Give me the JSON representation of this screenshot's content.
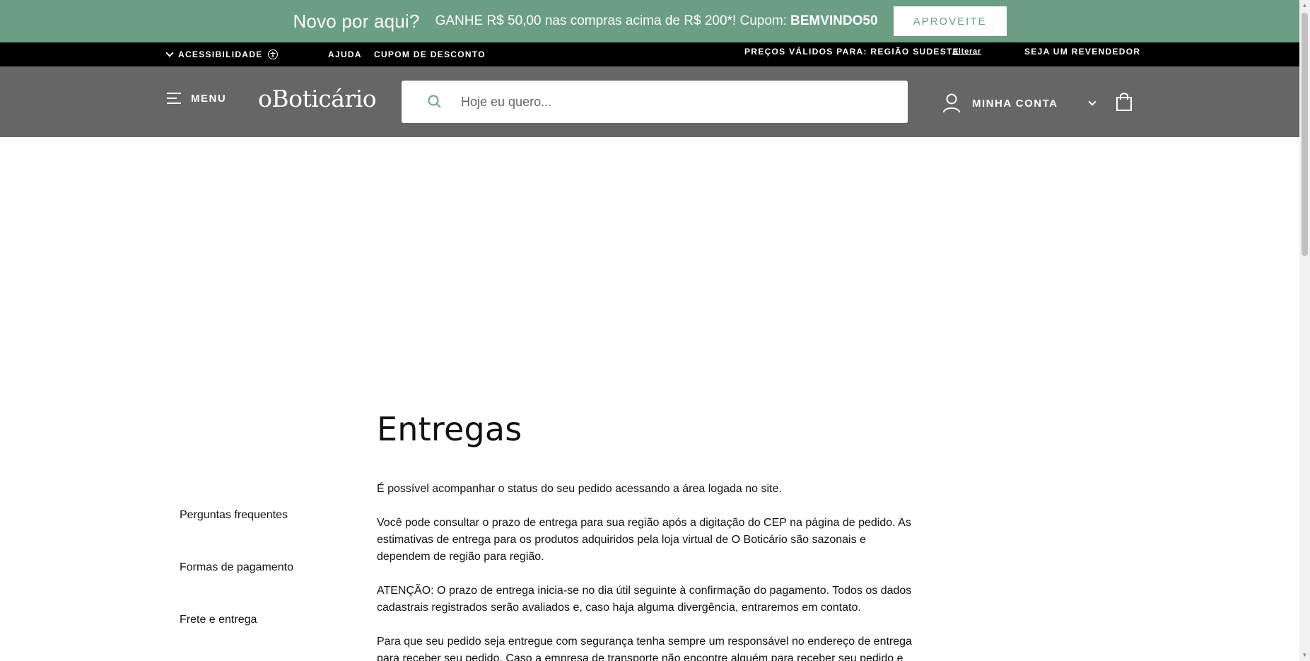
{
  "promo": {
    "title": "Novo por aqui?",
    "text": "GANHE R$ 50,00 nas compras acima de R$ 200*! Cupom:",
    "code": "BEMVINDO50",
    "button": "APROVEITE"
  },
  "utility": {
    "accessibility": "ACESSIBILIDADE",
    "help": "AJUDA",
    "coupon": "CUPOM DE DESCONTO",
    "region": "PREÇOS VÁLIDOS PARA: REGIÃO SUDESTE",
    "change": "Alterar",
    "reseller": "SEJA UM REVENDEDOR"
  },
  "header": {
    "menu": "MENU",
    "logo": "oBoticário",
    "search_placeholder": "Hoje eu quero...",
    "account": "MINHA CONTA"
  },
  "sidebar": {
    "items": [
      {
        "label": "Perguntas frequentes"
      },
      {
        "label": "Formas de pagamento"
      },
      {
        "label": "Frete e entrega"
      }
    ]
  },
  "content": {
    "title": "Entregas",
    "paragraphs": [
      "É possível acompanhar o status do seu pedido acessando a área logada no site.",
      "Você pode consultar o prazo de entrega para sua região após a digitação do CEP na página de pedido. As estimativas de entrega para os produtos adquiridos pela loja virtual de O Boticário são sazonais e dependem de região para região.",
      "ATENÇÃO: O prazo de entrega inicia-se no dia útil seguinte à confirmação do pagamento. Todos os dados cadastrais registrados serão avaliados e, caso haja alguma divergência, entraremos em contato.",
      "Para que seu pedido seja entregue com segurança tenha sempre um responsável no endereço de entrega para receber seu pedido. Caso a empresa de transporte não encontre alguém para receber seu pedido e assinar o"
    ]
  },
  "colors": {
    "promo_bg": "#6b9e83",
    "header_bg": "#666666",
    "utility_bg": "#000000"
  }
}
